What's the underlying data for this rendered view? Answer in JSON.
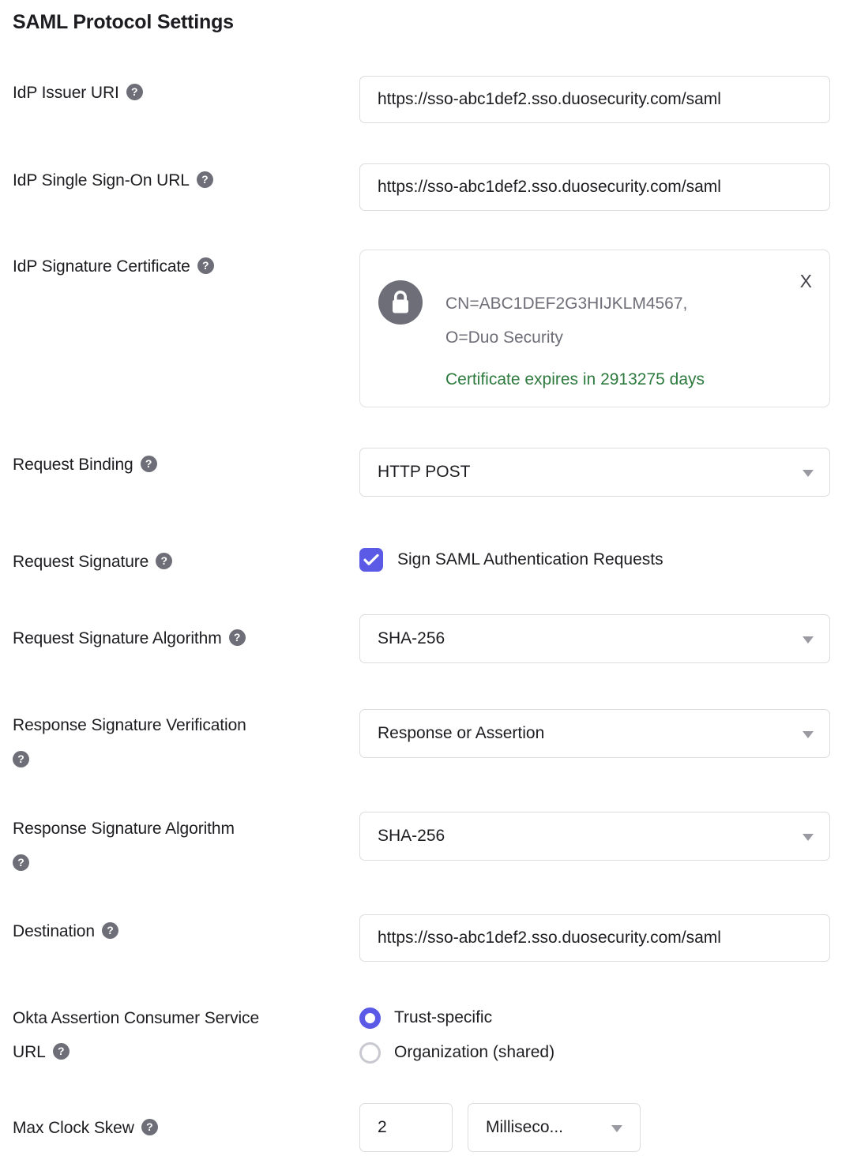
{
  "section": {
    "title": "SAML Protocol Settings"
  },
  "icons": {
    "help": "?",
    "remove": "X",
    "lock": "lock-icon",
    "caret": "chevron-down-icon",
    "check": "check-icon"
  },
  "colors": {
    "accent": "#5a5ae6",
    "text": "#1d1d21",
    "muted": "#6e6e78",
    "success": "#2d7a3e",
    "border": "#dcdce0"
  },
  "fields": {
    "idp_issuer_uri": {
      "label": "IdP Issuer URI",
      "value": "https://sso-abc1def2.sso.duosecurity.com/saml",
      "placeholder": ""
    },
    "idp_sso_url": {
      "label": "IdP Single Sign-On URL",
      "value": "https://sso-abc1def2.sso.duosecurity.com/saml",
      "placeholder": ""
    },
    "idp_signature_certificate": {
      "label": "IdP Signature Certificate",
      "subject_line1": "CN=ABC1DEF2G3HIJKLM4567,",
      "subject_line2": "O=Duo Security",
      "expiry": "Certificate expires in 2913275 days",
      "remove_label": "X"
    },
    "request_binding": {
      "label": "Request Binding",
      "value": "HTTP POST"
    },
    "request_signature": {
      "label": "Request Signature",
      "checkbox_label": "Sign SAML Authentication Requests",
      "checked": true
    },
    "request_signature_algorithm": {
      "label": "Request Signature Algorithm",
      "value": "SHA-256"
    },
    "response_signature_verification": {
      "label": "Response Signature Verification",
      "value": "Response or Assertion"
    },
    "response_signature_algorithm": {
      "label": "Response Signature Algorithm",
      "value": "SHA-256"
    },
    "destination": {
      "label": "Destination",
      "value": "https://sso-abc1def2.sso.duosecurity.com/saml",
      "placeholder": ""
    },
    "okta_acs_url": {
      "label_line1": "Okta Assertion Consumer Service",
      "label_line2": "URL",
      "options": [
        {
          "label": "Trust-specific",
          "selected": true
        },
        {
          "label": "Organization (shared)",
          "selected": false
        }
      ]
    },
    "max_clock_skew": {
      "label": "Max Clock Skew",
      "value": "2",
      "unit": "Milliseco..."
    }
  }
}
